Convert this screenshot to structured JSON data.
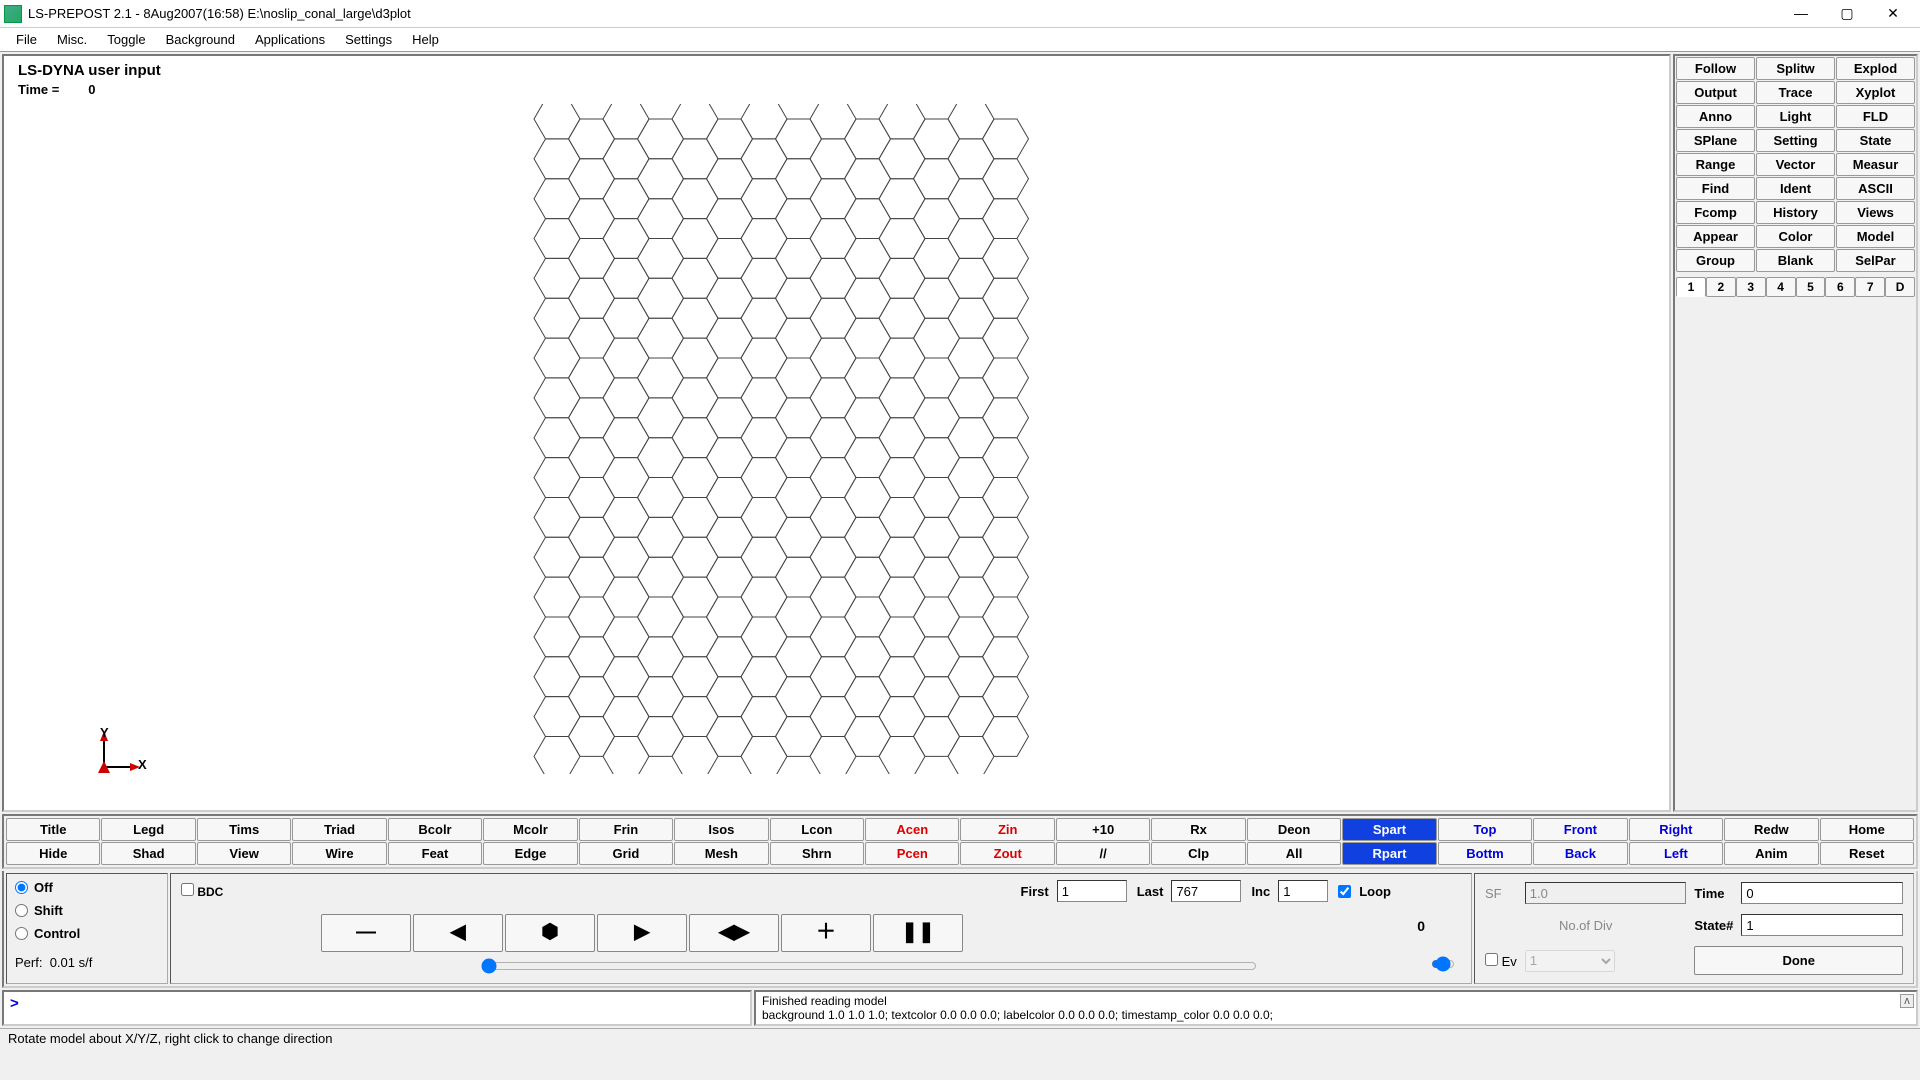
{
  "window": {
    "title": "LS-PREPOST 2.1 - 8Aug2007(16:58) E:\\noslip_conal_large\\d3plot"
  },
  "menu": [
    "File",
    "Misc.",
    "Toggle",
    "Background",
    "Applications",
    "Settings",
    "Help"
  ],
  "viewport": {
    "title": "LS-DYNA user input",
    "time_label": "Time =",
    "time_value": "0",
    "axis_y": "Y",
    "axis_x": "X"
  },
  "right_buttons": [
    [
      "Follow",
      "Splitw",
      "Explod"
    ],
    [
      "Output",
      "Trace",
      "Xyplot"
    ],
    [
      "Anno",
      "Light",
      "FLD"
    ],
    [
      "SPlane",
      "Setting",
      "State"
    ],
    [
      "Range",
      "Vector",
      "Measur"
    ],
    [
      "Find",
      "Ident",
      "ASCII"
    ],
    [
      "Fcomp",
      "History",
      "Views"
    ],
    [
      "Appear",
      "Color",
      "Model"
    ],
    [
      "Group",
      "Blank",
      "SelPar"
    ]
  ],
  "state_tabs": [
    "1",
    "2",
    "3",
    "4",
    "5",
    "6",
    "7",
    "D"
  ],
  "view_buttons_row1": [
    "Title",
    "Legd",
    "Tims",
    "Triad",
    "Bcolr",
    "Mcolr",
    "Frin",
    "Isos",
    "Lcon",
    "Acen",
    "Zin",
    "+10",
    "Rx",
    "Deon",
    "Spart",
    "Top",
    "Front",
    "Right",
    "Redw",
    "Home"
  ],
  "view_buttons_row2": [
    "Hide",
    "Shad",
    "View",
    "Wire",
    "Feat",
    "Edge",
    "Grid",
    "Mesh",
    "Shrn",
    "Pcen",
    "Zout",
    "//",
    "Clp",
    "All",
    "Rpart",
    "Bottm",
    "Back",
    "Left",
    "Anim",
    "Reset"
  ],
  "view_red": [
    "Acen",
    "Zin",
    "Pcen",
    "Zout"
  ],
  "view_blue": [
    "Top",
    "Front",
    "Right",
    "Bottm",
    "Back",
    "Left"
  ],
  "view_selblue": [
    "Spart",
    "Rpart"
  ],
  "anim": {
    "radios": [
      "Off",
      "Shift",
      "Control"
    ],
    "perf_label": "Perf:",
    "perf_value": "0.01 s/f",
    "bdc": "BDC",
    "first_label": "First",
    "first_value": "1",
    "last_label": "Last",
    "last_value": "767",
    "inc_label": "Inc",
    "inc_value": "1",
    "loop_label": "Loop",
    "frame_num": "0",
    "sf_label": "SF",
    "sf_value": "1.0",
    "time_label": "Time",
    "time_value": "0",
    "div_label": "No.of Div",
    "state_label": "State#",
    "state_value": "1",
    "ev_label": "Ev",
    "ev_value": "1",
    "done": "Done"
  },
  "cmd": {
    "prompt": ">",
    "log1": "Finished reading model",
    "log2": "background 1.0 1.0 1.0; textcolor 0.0 0.0 0.0; labelcolor 0.0 0.0 0.0; timestamp_color 0.0 0.0 0.0;"
  },
  "status": "Rotate model about X/Y/Z, right click to change direction"
}
